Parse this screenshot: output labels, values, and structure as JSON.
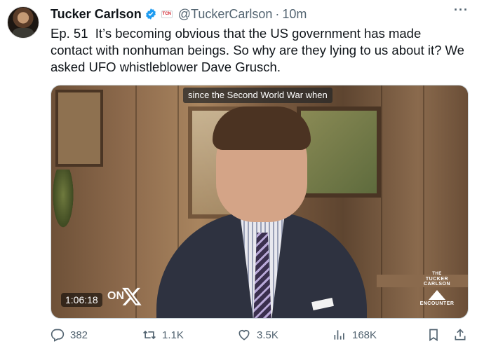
{
  "author": {
    "name": "Tucker Carlson",
    "handle": "@TuckerCarlson",
    "separator": "·",
    "time": "10m",
    "badge_text": "TCN"
  },
  "tweet": {
    "text": "Ep. 51  It’s becoming obvious that the US government has made contact with nonhuman beings. So why are they lying to us about it? We asked UFO whistleblower Dave Grusch."
  },
  "video": {
    "caption": "since the Second World War when",
    "timestamp": "1:06:18",
    "watermark_text": "ON",
    "logo": {
      "top": "THE",
      "arc": "TUCKER CARLSON",
      "bottom": "ENCOUNTER"
    }
  },
  "actions": {
    "replies": "382",
    "reposts": "1.1K",
    "likes": "3.5K",
    "views": "168K"
  },
  "colors": {
    "verified": "#1d9bf0",
    "muted": "#536471",
    "text": "#0f1419"
  },
  "icons": [
    "more-icon",
    "verified-icon",
    "reply-icon",
    "repost-icon",
    "like-icon",
    "views-icon",
    "bookmark-icon",
    "share-icon",
    "x-logo-icon"
  ]
}
